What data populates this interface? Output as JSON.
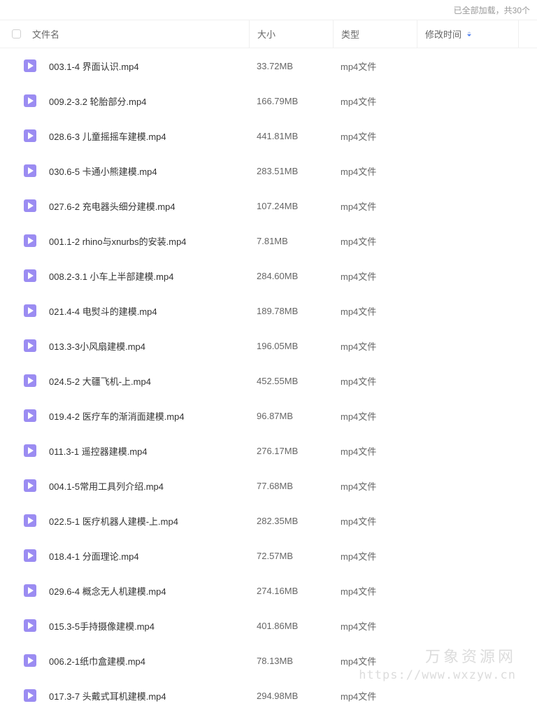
{
  "status": {
    "loaded_text": "已全部加载，共30个"
  },
  "header": {
    "name": "文件名",
    "size": "大小",
    "type": "类型",
    "mtime": "修改时间"
  },
  "files": [
    {
      "name": "003.1-4 界面认识.mp4",
      "size": "33.72MB",
      "type": "mp4文件"
    },
    {
      "name": "009.2-3.2 轮胎部分.mp4",
      "size": "166.79MB",
      "type": "mp4文件"
    },
    {
      "name": "028.6-3 儿童摇摇车建模.mp4",
      "size": "441.81MB",
      "type": "mp4文件"
    },
    {
      "name": "030.6-5 卡通小熊建模.mp4",
      "size": "283.51MB",
      "type": "mp4文件"
    },
    {
      "name": "027.6-2 充电器头细分建模.mp4",
      "size": "107.24MB",
      "type": "mp4文件"
    },
    {
      "name": "001.1-2 rhino与xnurbs的安装.mp4",
      "size": "7.81MB",
      "type": "mp4文件"
    },
    {
      "name": "008.2-3.1 小车上半部建模.mp4",
      "size": "284.60MB",
      "type": "mp4文件"
    },
    {
      "name": "021.4-4 电熨斗的建模.mp4",
      "size": "189.78MB",
      "type": "mp4文件"
    },
    {
      "name": "013.3-3小风扇建模.mp4",
      "size": "196.05MB",
      "type": "mp4文件"
    },
    {
      "name": "024.5-2 大疆飞机-上.mp4",
      "size": "452.55MB",
      "type": "mp4文件"
    },
    {
      "name": "019.4-2 医疗车的渐消面建模.mp4",
      "size": "96.87MB",
      "type": "mp4文件"
    },
    {
      "name": "011.3-1 遥控器建模.mp4",
      "size": "276.17MB",
      "type": "mp4文件"
    },
    {
      "name": "004.1-5常用工具列介绍.mp4",
      "size": "77.68MB",
      "type": "mp4文件"
    },
    {
      "name": "022.5-1 医疗机器人建模-上.mp4",
      "size": "282.35MB",
      "type": "mp4文件"
    },
    {
      "name": "018.4-1 分面理论.mp4",
      "size": "72.57MB",
      "type": "mp4文件"
    },
    {
      "name": "029.6-4 概念无人机建模.mp4",
      "size": "274.16MB",
      "type": "mp4文件"
    },
    {
      "name": "015.3-5手持摄像建模.mp4",
      "size": "401.86MB",
      "type": "mp4文件"
    },
    {
      "name": "006.2-1纸巾盒建模.mp4",
      "size": "78.13MB",
      "type": "mp4文件"
    },
    {
      "name": "017.3-7 头戴式耳机建模.mp4",
      "size": "294.98MB",
      "type": "mp4文件"
    }
  ],
  "watermark": {
    "title": "万象资源网",
    "url": "https://www.wxzyw.cn"
  },
  "colors": {
    "icon_purple": "#9b8cf2",
    "sort_active": "#4a7cf0"
  }
}
